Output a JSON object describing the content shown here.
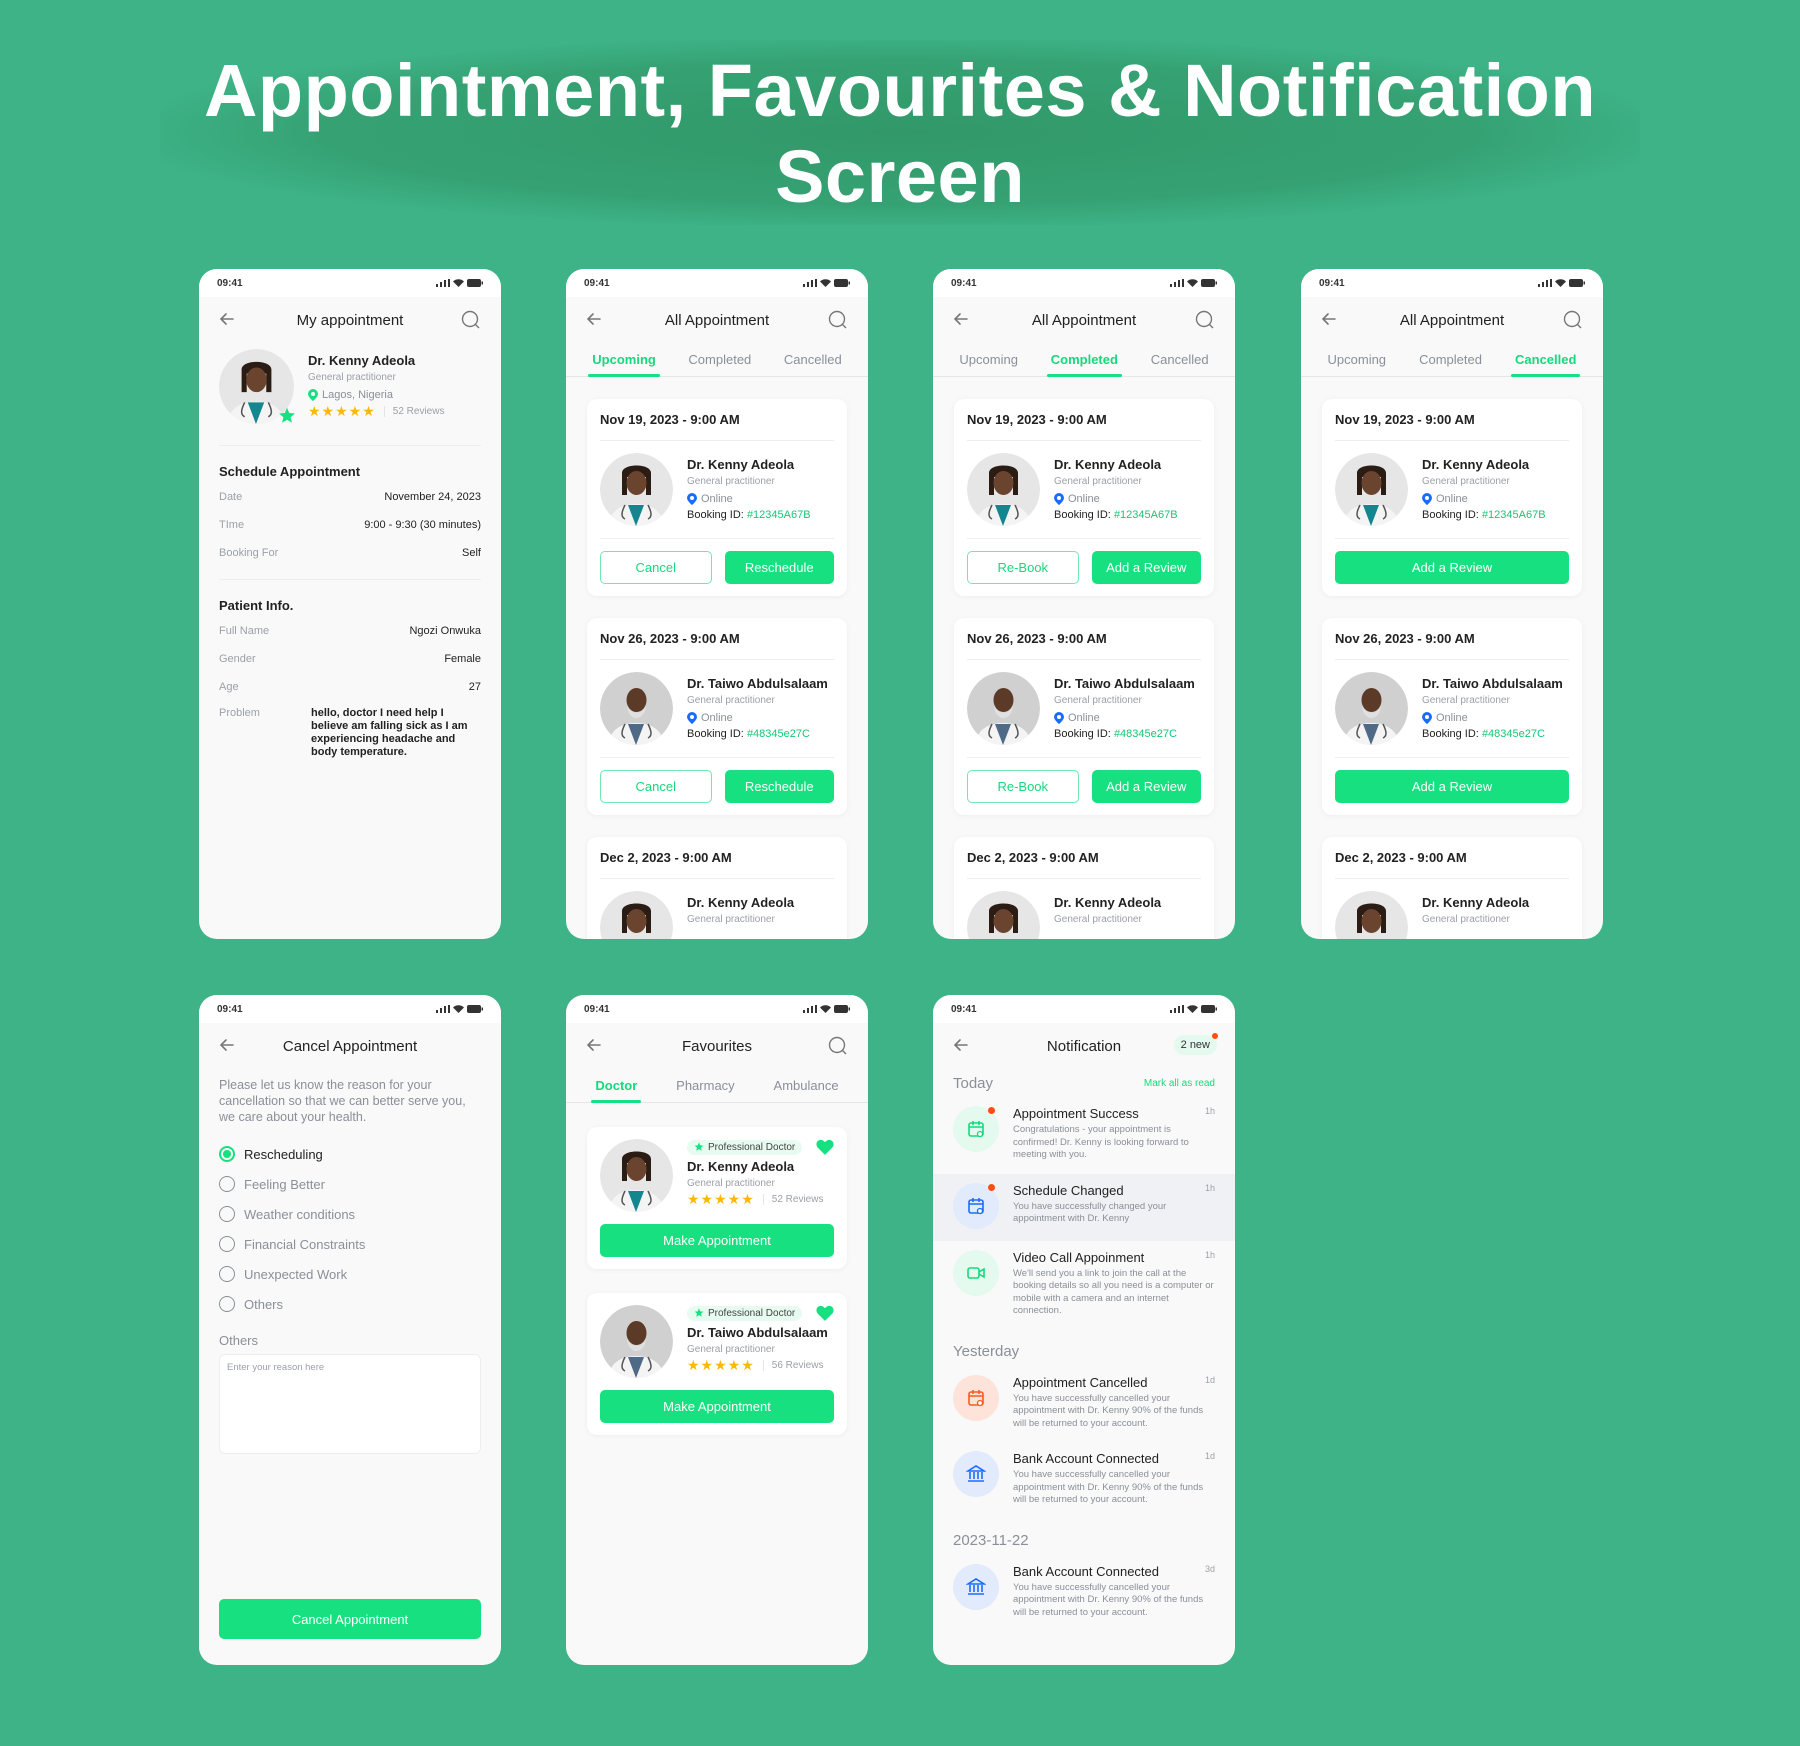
{
  "page": {
    "title_line1": "Appointment, Favourites & Notification",
    "title_line2": "Screen"
  },
  "colors": {
    "background": "#3db387",
    "accent": "#16e07f",
    "star": "#ffb800",
    "unread_dot": "#ff4d12",
    "online_pin": "#1a6cff"
  },
  "status_bar": {
    "time": "09:41"
  },
  "my_appointment": {
    "title": "My appointment",
    "doctor": {
      "name": "Dr. Kenny Adeola",
      "specialty": "General practitioner",
      "location": "Lagos, Nigeria",
      "rating": 5,
      "reviews": "52 Reviews",
      "avatar": "female-doctor"
    },
    "schedule_heading": "Schedule Appointment",
    "schedule": [
      {
        "label": "Date",
        "value": "November 24, 2023"
      },
      {
        "label": "TIme",
        "value": "9:00 - 9:30 (30 minutes)"
      },
      {
        "label": "Booking For",
        "value": "Self"
      }
    ],
    "patient_heading": "Patient Info.",
    "patient": [
      {
        "label": "Full Name",
        "value": "Ngozi Onwuka"
      },
      {
        "label": "Gender",
        "value": "Female"
      },
      {
        "label": "Age",
        "value": "27"
      }
    ],
    "problem_label": "Problem",
    "problem_value": "hello, doctor I need help I believe am falling sick as I am experiencing headache and body temperature."
  },
  "all_appointment": [
    {
      "title": "All Appointment",
      "tabs": [
        "Upcoming",
        "Completed",
        "Cancelled"
      ],
      "active_tab": 0,
      "cards": [
        {
          "date": "Nov 19, 2023 - 9:00 AM",
          "name": "Dr. Kenny Adeola",
          "specialty": "General practitioner",
          "mode": "Online",
          "booking_label": "Booking ID:",
          "booking_id": "#12345A67B",
          "avatar": "female-doctor",
          "buttons": [
            {
              "label": "Cancel",
              "style": "outline"
            },
            {
              "label": "Reschedule",
              "style": "filled"
            }
          ]
        },
        {
          "date": "Nov 26, 2023 - 9:00 AM",
          "name": "Dr. Taiwo Abdulsalaam",
          "specialty": "General practitioner",
          "mode": "Online",
          "booking_label": "Booking ID:",
          "booking_id": "#48345e27C",
          "avatar": "male-doctor",
          "buttons": [
            {
              "label": "Cancel",
              "style": "outline"
            },
            {
              "label": "Reschedule",
              "style": "filled"
            }
          ]
        },
        {
          "date": "Dec 2, 2023 - 9:00 AM",
          "name": "Dr. Kenny Adeola",
          "specialty": "General practitioner",
          "avatar": "female-doctor"
        }
      ]
    },
    {
      "title": "All Appointment",
      "tabs": [
        "Upcoming",
        "Completed",
        "Cancelled"
      ],
      "active_tab": 1,
      "cards": [
        {
          "date": "Nov 19, 2023 - 9:00 AM",
          "name": "Dr. Kenny Adeola",
          "specialty": "General practitioner",
          "mode": "Online",
          "booking_label": "Booking ID:",
          "booking_id": "#12345A67B",
          "avatar": "female-doctor",
          "buttons": [
            {
              "label": "Re-Book",
              "style": "outline"
            },
            {
              "label": "Add a Review",
              "style": "filled"
            }
          ]
        },
        {
          "date": "Nov 26, 2023 - 9:00 AM",
          "name": "Dr. Taiwo Abdulsalaam",
          "specialty": "General practitioner",
          "mode": "Online",
          "booking_label": "Booking ID:",
          "booking_id": "#48345e27C",
          "avatar": "male-doctor",
          "buttons": [
            {
              "label": "Re-Book",
              "style": "outline"
            },
            {
              "label": "Add a Review",
              "style": "filled"
            }
          ]
        },
        {
          "date": "Dec 2, 2023 - 9:00 AM",
          "name": "Dr. Kenny Adeola",
          "specialty": "General practitioner",
          "avatar": "female-doctor"
        }
      ]
    },
    {
      "title": "All Appointment",
      "tabs": [
        "Upcoming",
        "Completed",
        "Cancelled"
      ],
      "active_tab": 2,
      "cards": [
        {
          "date": "Nov 19, 2023 - 9:00 AM",
          "name": "Dr. Kenny Adeola",
          "specialty": "General practitioner",
          "mode": "Online",
          "booking_label": "Booking ID:",
          "booking_id": "#12345A67B",
          "avatar": "female-doctor",
          "buttons": [
            {
              "label": "Add a Review",
              "style": "filled"
            }
          ]
        },
        {
          "date": "Nov 26, 2023 - 9:00 AM",
          "name": "Dr. Taiwo Abdulsalaam",
          "specialty": "General practitioner",
          "mode": "Online",
          "booking_label": "Booking ID:",
          "booking_id": "#48345e27C",
          "avatar": "male-doctor",
          "buttons": [
            {
              "label": "Add a Review",
              "style": "filled"
            }
          ]
        },
        {
          "date": "Dec 2, 2023 - 9:00 AM",
          "name": "Dr. Kenny Adeola",
          "specialty": "General practitioner",
          "avatar": "female-doctor"
        }
      ]
    }
  ],
  "cancel": {
    "title": "Cancel Appointment",
    "intro": "Please let us know the reason for your cancellation so that we can better serve you, we care about your health.",
    "reasons": [
      "Rescheduling",
      "Feeling Better",
      "Weather conditions",
      "Financial Constraints",
      "Unexpected Work",
      "Others"
    ],
    "selected": 0,
    "others_label": "Others",
    "others_placeholder": "Enter your reason here",
    "submit": "Cancel Appointment"
  },
  "favourites": {
    "title": "Favourites",
    "tabs": [
      "Doctor",
      "Pharmacy",
      "Ambulance"
    ],
    "active_tab": 0,
    "cards": [
      {
        "badge": "Professional Doctor",
        "name": "Dr. Kenny Adeola",
        "specialty": "General practitioner",
        "rating": 5,
        "reviews": "52 Reviews",
        "avatar": "female-doctor",
        "button": "Make Appointment"
      },
      {
        "badge": "Professional Doctor",
        "name": "Dr. Taiwo Abdulsalaam",
        "specialty": "General practitioner",
        "rating": 5,
        "reviews": "56 Reviews",
        "avatar": "male-doctor",
        "button": "Make Appointment"
      }
    ]
  },
  "notification": {
    "title": "Notification",
    "new_badge": "2 new",
    "mark_all": "Mark all as read",
    "sections": [
      {
        "label": "Today",
        "items": [
          {
            "icon": "calendar-check-icon",
            "tone": "green",
            "unread": true,
            "highlight": false,
            "title": "Appointment Success",
            "time": "1h",
            "body": "Congratulations - your appointment is confirmed! Dr. Kenny is looking forward to meeting with you."
          },
          {
            "icon": "calendar-icon",
            "tone": "blue",
            "unread": true,
            "highlight": true,
            "title": "Schedule Changed",
            "time": "1h",
            "body": "You have successfully changed your appointment with Dr. Kenny"
          },
          {
            "icon": "video-icon",
            "tone": "green",
            "unread": false,
            "highlight": false,
            "title": "Video Call Appoinment",
            "time": "1h",
            "body": "We'll send you a link to join the call at the booking details so all you need is a computer or mobile with a camera and an internet connection."
          }
        ]
      },
      {
        "label": "Yesterday",
        "items": [
          {
            "icon": "calendar-x-icon",
            "tone": "red",
            "unread": false,
            "highlight": false,
            "title": "Appointment Cancelled",
            "time": "1d",
            "body": "You have successfully cancelled your appointment with Dr. Kenny 90% of the funds will be returned to your account."
          },
          {
            "icon": "bank-icon",
            "tone": "blue",
            "unread": false,
            "highlight": false,
            "title": "Bank Account Connected",
            "time": "1d",
            "body": "You have successfully cancelled your appointment with Dr. Kenny 90% of the funds will be returned to your account."
          }
        ]
      },
      {
        "label": "2023-11-22",
        "items": [
          {
            "icon": "bank-icon",
            "tone": "blue",
            "unread": false,
            "highlight": false,
            "title": "Bank Account Connected",
            "time": "3d",
            "body": "You have successfully cancelled your appointment with Dr. Kenny 90% of the funds will be returned to your account."
          }
        ]
      }
    ]
  }
}
